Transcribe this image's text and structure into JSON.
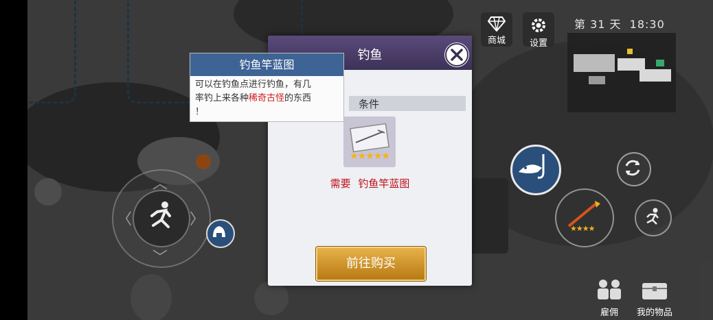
{
  "hud": {
    "shop_label": "商城",
    "settings_label": "设置",
    "day_label": "第 31 天",
    "time": "18:30"
  },
  "modal": {
    "title": "钓鱼",
    "condition_label": "条件",
    "requirement_prefix": "需要",
    "requirement_item": "钓鱼竿蓝图",
    "item_stars": 5,
    "buy_button": "前往购买"
  },
  "tooltip": {
    "title": "钓鱼竿蓝图",
    "desc_line1": "可以在钓鱼点进行钓鱼，有几",
    "desc_line2_pre": "率钓上来各种",
    "desc_highlight": "稀奇古怪",
    "desc_line2_post": "的东西",
    "desc_line3": "！"
  },
  "bottom_right": {
    "mercenary_label": "雇佣",
    "my_items_label": "我的物品"
  },
  "weapon": {
    "stars": 4
  },
  "colors": {
    "modal_header": "#4a3d68",
    "tooltip_header": "#3e6395",
    "requirement_text": "#c0101a",
    "buy_button": "#d69a2e",
    "star": "#f2b31b"
  },
  "icons": [
    "diamond-icon",
    "gear-icon",
    "close-icon",
    "fishing-icon",
    "refresh-icon",
    "run-icon",
    "sprint-icon",
    "campfire-icon",
    "mercenary-icon",
    "chest-icon",
    "fishing-rod-blueprint-icon"
  ]
}
